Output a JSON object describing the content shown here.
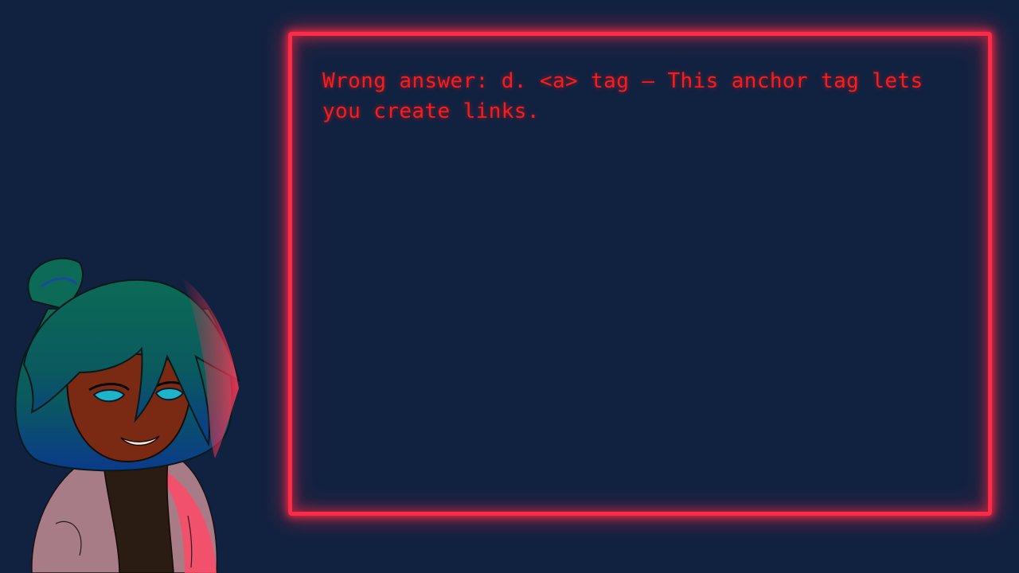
{
  "dialogue": {
    "text": "Wrong answer: d. <a> tag – This anchor tag lets you create links."
  },
  "character": {
    "icon": "character-portrait"
  },
  "colors": {
    "background": "#112240",
    "neon_frame": "#ff2a46",
    "text": "#ff1a1a",
    "hair": "#0a6b5a",
    "skin": "#7a2a12",
    "hoodie": "#e8c4c8",
    "scarf": "#2a1a10",
    "eyes": "#1fb3c9"
  }
}
